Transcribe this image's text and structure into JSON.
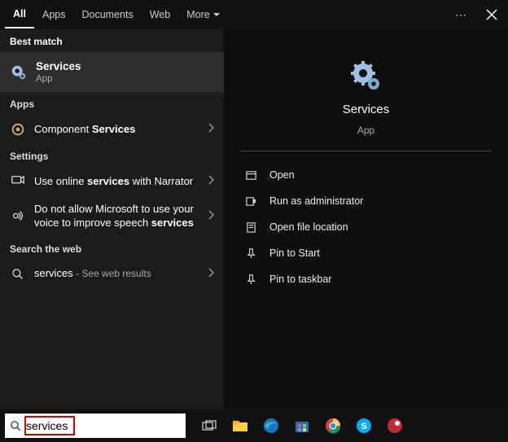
{
  "tabs": {
    "all": "All",
    "apps": "Apps",
    "documents": "Documents",
    "web": "Web",
    "more": "More"
  },
  "sections": {
    "best_match": "Best match",
    "apps": "Apps",
    "settings": "Settings",
    "search_web": "Search the web"
  },
  "best_match": {
    "title": "Services",
    "subtitle": "App"
  },
  "apps_list": [
    {
      "label_pre": "Component ",
      "label_bold": "Services"
    }
  ],
  "settings_list": [
    {
      "label_pre": "Use online ",
      "label_bold": "services",
      "label_post": " with Narrator"
    },
    {
      "label_pre": "Do not allow Microsoft to use your voice to improve speech ",
      "label_bold": "services",
      "label_post": ""
    }
  ],
  "web_list": [
    {
      "term": "services",
      "suffix": " - See web results"
    }
  ],
  "preview": {
    "title": "Services",
    "subtitle": "App"
  },
  "actions": {
    "open": "Open",
    "run_admin": "Run as administrator",
    "open_loc": "Open file location",
    "pin_start": "Pin to Start",
    "pin_taskbar": "Pin to taskbar"
  },
  "search": {
    "value": "services"
  }
}
